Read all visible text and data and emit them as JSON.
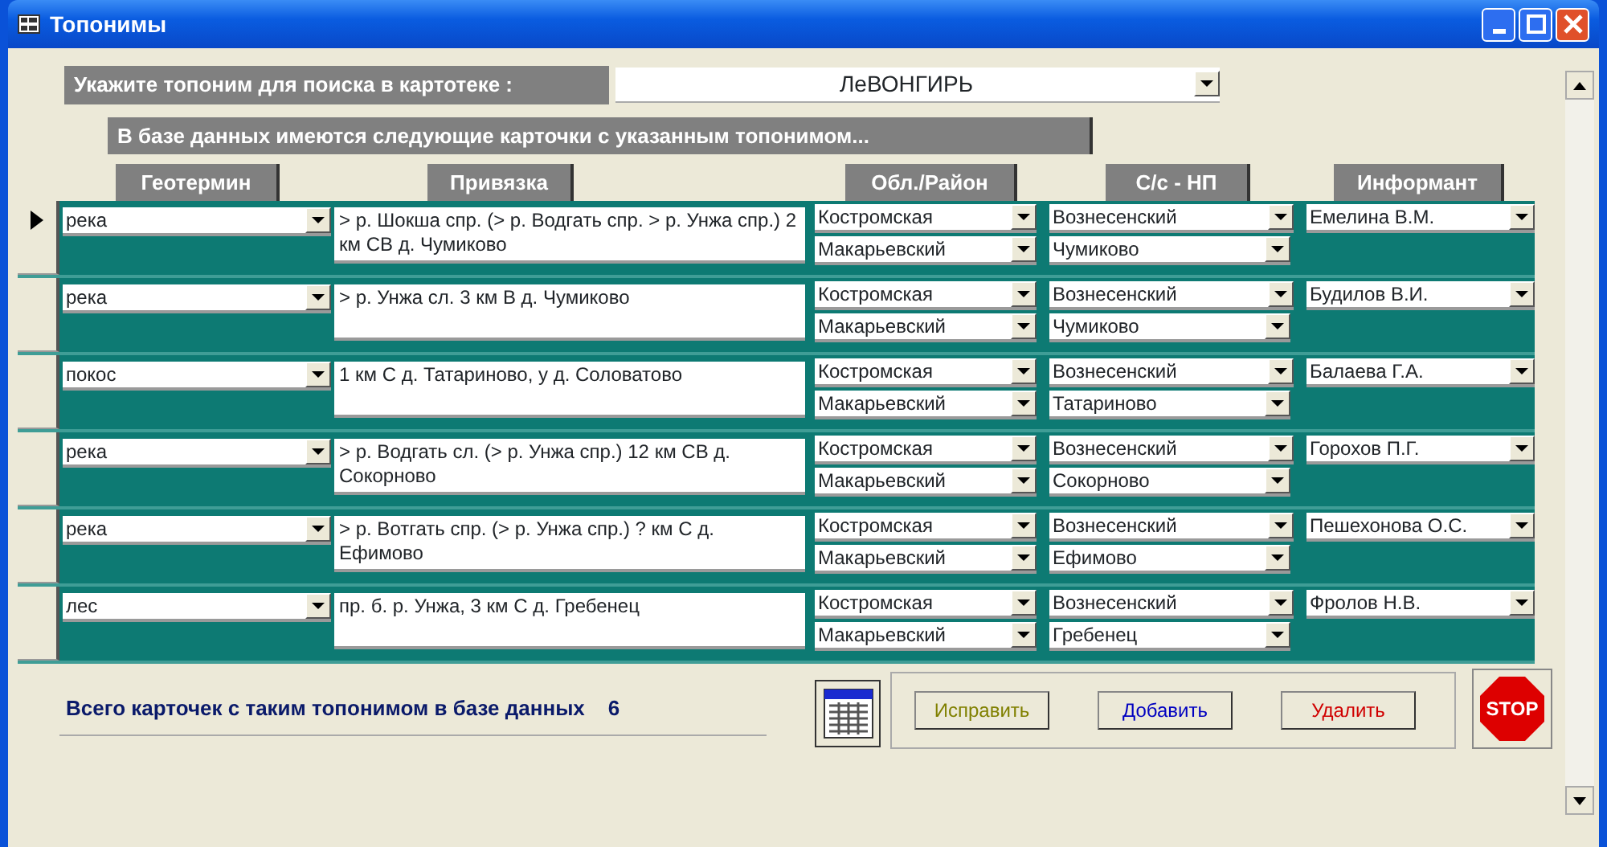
{
  "window": {
    "title": "Топонимы"
  },
  "search": {
    "label": "Укажите топоним для поиска в картотеке :",
    "value": "ЛеВОНГИРЬ"
  },
  "info": "В базе данных имеются следующие карточки с указанным топонимом...",
  "columns": [
    "Геотермин",
    "Привязка",
    "Обл./Район",
    "С/с - НП",
    "Информант"
  ],
  "records": [
    {
      "selected": true,
      "geoterm": "река",
      "binding": "> р. Шокша спр. (> р. Водгать спр. > р. Унжа спр.) 2 км СВ д. Чумиково",
      "region": "Костромская",
      "district": "Макарьевский",
      "council": "Вознесенский",
      "settlement": "Чумиково",
      "informant": "Емелина В.М."
    },
    {
      "selected": false,
      "geoterm": "река",
      "binding": "> р. Унжа сл. 3 км В д. Чумиково",
      "region": "Костромская",
      "district": "Макарьевский",
      "council": "Вознесенский",
      "settlement": "Чумиково",
      "informant": "Будилов В.И."
    },
    {
      "selected": false,
      "geoterm": "покос",
      "binding": "1 км С д. Татариново, у д. Соловатово",
      "region": "Костромская",
      "district": "Макарьевский",
      "council": "Вознесенский",
      "settlement": "Татариново",
      "informant": "Балаева Г.А."
    },
    {
      "selected": false,
      "geoterm": "река",
      "binding": "> р. Водгать сл. (> р. Унжа спр.) 12 км СВ д. Сокорново",
      "region": "Костромская",
      "district": "Макарьевский",
      "council": "Вознесенский",
      "settlement": "Сокорново",
      "informant": "Горохов П.Г."
    },
    {
      "selected": false,
      "geoterm": "река",
      "binding": "> р. Вотгать спр. (> р. Унжа спр.) ? км С д. Ефимово",
      "region": "Костромская",
      "district": "Макарьевский",
      "council": "Вознесенский",
      "settlement": "Ефимово",
      "informant": "Пешехонова О.С."
    },
    {
      "selected": false,
      "geoterm": "лес",
      "binding": "пр. б. р. Унжа, 3 км С д. Гребенец",
      "region": "Костромская",
      "district": "Макарьевский",
      "council": "Вознесенский",
      "settlement": "Гребенец",
      "informant": "Фролов Н.В."
    }
  ],
  "total": {
    "label": "Всего карточек с таким топонимом в базе данных",
    "count": "6"
  },
  "buttons": [
    {
      "label": "Исправить",
      "color": "#808000"
    },
    {
      "label": "Добавить",
      "color": "#0000c0"
    },
    {
      "label": "Удалить",
      "color": "#d00000"
    }
  ],
  "stop_button": {
    "label": "STOP"
  }
}
